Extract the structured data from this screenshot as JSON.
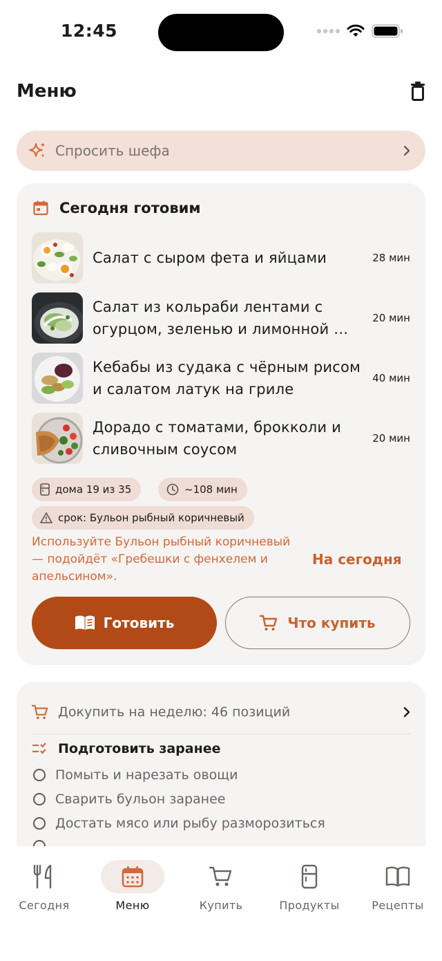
{
  "status": {
    "time": "12:45"
  },
  "header": {
    "title": "Меню"
  },
  "ask_chef": {
    "label": "Спросить шефа"
  },
  "today": {
    "title": "Сегодня готовим",
    "recipes": [
      {
        "name": "Салат с сыром фета и яйцами",
        "time": "28 мин"
      },
      {
        "name": "Салат из кольраби лентами с огурцом, зеленью и лимонной …",
        "time": "20 мин"
      },
      {
        "name": "Кебабы из судака с чёрным рисом и салатом латук на гриле",
        "time": "40 мин"
      },
      {
        "name": "Дорадо с томатами, брокколи и сливочным соусом",
        "time": "20 мин"
      }
    ],
    "chips": {
      "home": "дома 19 из 35",
      "duration": "~108 мин",
      "expiry": "срок: Бульон рыбный коричневый"
    },
    "tip": "Используйте Бульон рыбный коричневый — подойдёт «Гребешки с фенхелем и апельсином».",
    "tip_action": "На сегодня",
    "cook_label": "Готовить",
    "buy_label": "Что купить"
  },
  "week": {
    "buy_label": "Докупить на неделю: 46 позиций",
    "prep_title": "Подготовить заранее",
    "prep_items": [
      "Помыть и нарезать овощи",
      "Сварить бульон заранее",
      "Достать мясо или рыбу разморозиться"
    ]
  },
  "tabs": [
    {
      "label": "Сегодня",
      "icon": "fork-knife-icon"
    },
    {
      "label": "Меню",
      "icon": "calendar-icon",
      "active": true
    },
    {
      "label": "Купить",
      "icon": "cart-icon"
    },
    {
      "label": "Продукты",
      "icon": "fridge-icon"
    },
    {
      "label": "Рецепты",
      "icon": "book-icon"
    }
  ],
  "colors": {
    "accent": "#c9612f",
    "primary_button": "#b24a18",
    "chip_bg": "#efdcd5",
    "card_bg": "#f5f4f2"
  }
}
